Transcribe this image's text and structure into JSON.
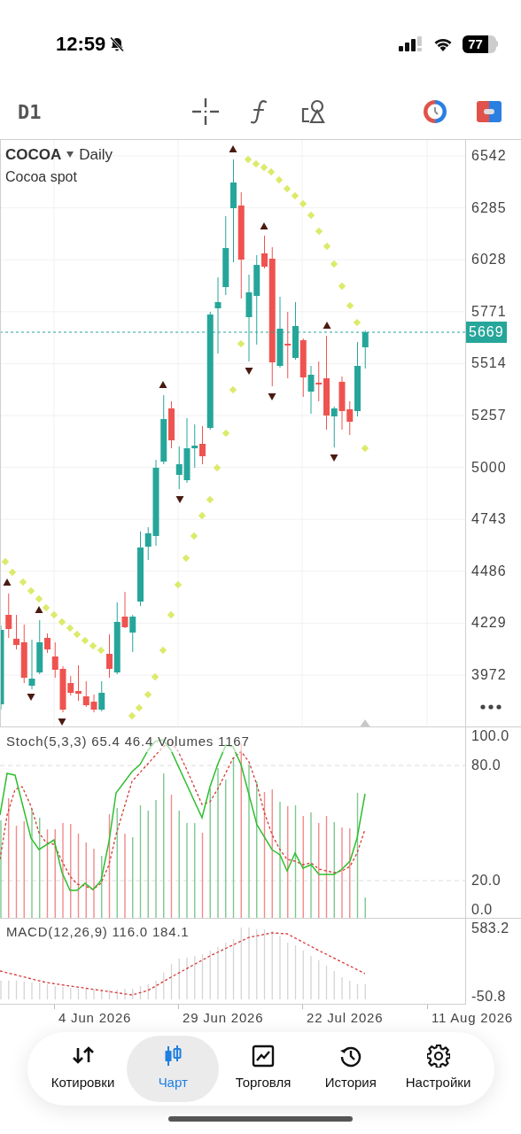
{
  "status_bar": {
    "time": "12:59",
    "battery": "77"
  },
  "toolbar": {
    "timeframe": "D1"
  },
  "chart": {
    "symbol": "COCOA",
    "period": "Daily",
    "description": "Cocoa spot",
    "price_axis": [
      "6542",
      "6285",
      "6028",
      "5771",
      "5514",
      "5257",
      "5000",
      "4743",
      "4486",
      "4229",
      "3972"
    ],
    "current_price": "5669",
    "stoch_legend": "Stoch(5,3,3) 65.4 46.4 Volumes 1167",
    "stoch_axis": [
      "100.0",
      "80.0",
      "20.0",
      "0.0"
    ],
    "macd_legend": "MACD(12,26,9) 116.0 184.1",
    "macd_axis": [
      "583.2",
      "-50.8"
    ],
    "date_axis": [
      "4 Jun 2026",
      "29 Jun 2026",
      "22 Jul 2026",
      "11 Aug 2026"
    ]
  },
  "tab_bar": [
    {
      "label": "Котировки",
      "selected": false
    },
    {
      "label": "Чарт",
      "selected": true
    },
    {
      "label": "Торговля",
      "selected": false
    },
    {
      "label": "История",
      "selected": false
    },
    {
      "label": "Настройки",
      "selected": false
    }
  ]
}
